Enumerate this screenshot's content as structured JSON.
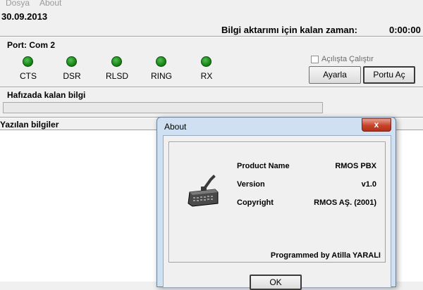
{
  "menu": {
    "file": "Dosya",
    "about": "About"
  },
  "header": {
    "date": "30.09.2013",
    "remaining_label": "Bilgi aktarımı için kalan zaman:",
    "remaining_value": "0:00:00"
  },
  "port": {
    "label": "Port: Com 2",
    "leds": [
      {
        "label": "CTS",
        "color": "#1d8a1d"
      },
      {
        "label": "DSR",
        "color": "#1d8a1d"
      },
      {
        "label": "RLSD",
        "color": "#1d8a1d"
      },
      {
        "label": "RING",
        "color": "#1d8a1d"
      },
      {
        "label": "RX",
        "color": "#1d8a1d"
      }
    ]
  },
  "controls": {
    "autostart_label": "Açılışta Çalıştır",
    "autostart_checked": false,
    "setup_button": "Ayarla",
    "open_port_button": "Portu Aç"
  },
  "memory": {
    "label": "Hafızada kalan bilgi",
    "progress": 0
  },
  "written": {
    "label": "Yazılan bilgiler",
    "text": ""
  },
  "about_dialog": {
    "title": "About",
    "close": "x",
    "icon": "modem-icon",
    "product_name_label": "Product Name",
    "product_name_value": "RMOS PBX",
    "version_label": "Version",
    "version_value": "v1.0",
    "copyright_label": "Copyright",
    "copyright_value": "RMOS AŞ. (2001)",
    "author": "Programmed by Atilla YARALI",
    "ok_button": "OK"
  }
}
